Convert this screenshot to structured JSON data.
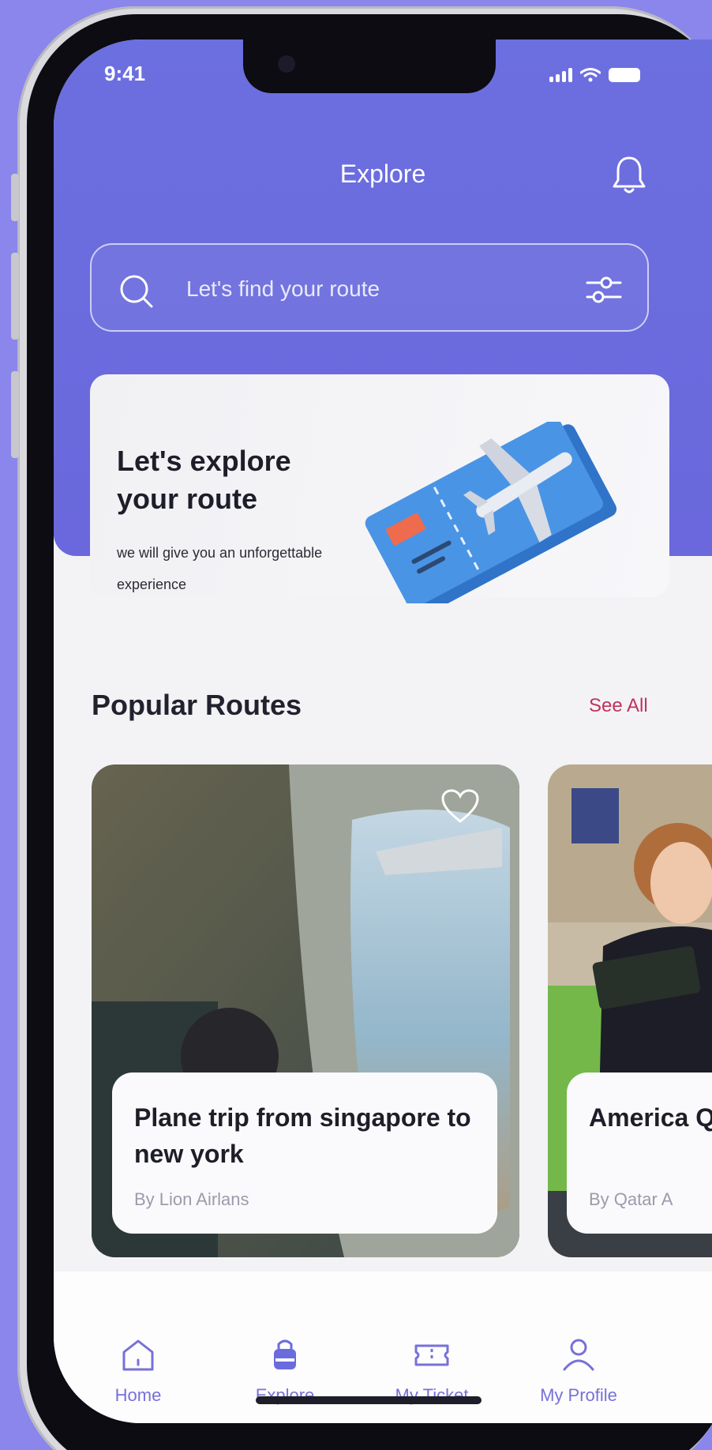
{
  "status": {
    "time": "9:41"
  },
  "header": {
    "title": "Explore"
  },
  "search": {
    "placeholder": "Let's find your route"
  },
  "banner": {
    "title": "Let's explore your route",
    "subtitle": "we will give you an unforgettable experience"
  },
  "popular": {
    "heading": "Popular Routes",
    "see_all": "See All"
  },
  "routes": [
    {
      "name": "Plane trip from singapore to new york",
      "by": "By Lion Airlans"
    },
    {
      "name": "America Qatar Ai",
      "by": "By Qatar A"
    }
  ],
  "tabs": [
    {
      "label": "Home",
      "icon": "home-icon"
    },
    {
      "label": "Explore",
      "icon": "bag-icon"
    },
    {
      "label": "My Ticket",
      "icon": "ticket-icon"
    },
    {
      "label": "My Profile",
      "icon": "profile-icon"
    }
  ],
  "colors": {
    "primary": "#6a6cdd",
    "accent": "#c2325b",
    "tab_label": "#7771d8",
    "background": "#8a86ec"
  }
}
